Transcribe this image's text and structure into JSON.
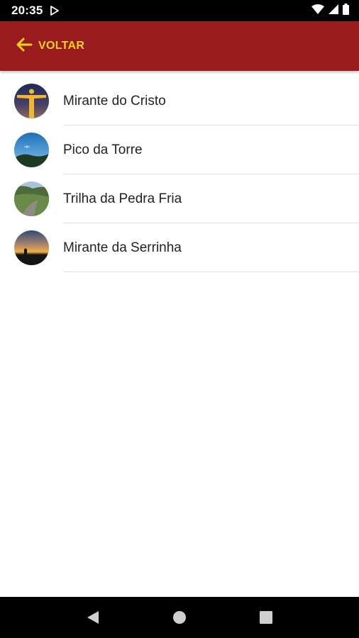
{
  "status_bar": {
    "time": "20:35",
    "icons": [
      "play-store-icon",
      "wifi-icon",
      "signal-icon",
      "battery-icon"
    ]
  },
  "app_bar": {
    "back_label": "VOLTAR",
    "background_color": "#991b1e",
    "accent_color": "#ffd21f"
  },
  "places": [
    {
      "label": "Mirante do Cristo",
      "thumbnail": "statue-at-dusk"
    },
    {
      "label": "Pico da Torre",
      "thumbnail": "blue-sky-hill"
    },
    {
      "label": "Trilha da Pedra Fria",
      "thumbnail": "forest-trail"
    },
    {
      "label": "Mirante da Serrinha",
      "thumbnail": "sunset-silhouette"
    }
  ],
  "nav_bar": {
    "buttons": [
      "back-triangle-icon",
      "home-circle-icon",
      "recents-square-icon"
    ]
  }
}
